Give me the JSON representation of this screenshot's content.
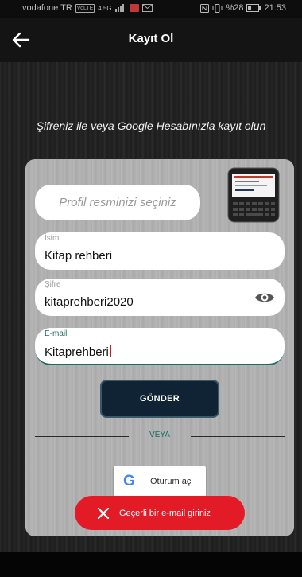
{
  "status_bar": {
    "carrier": "vodafone TR",
    "volte_badge": "VoLTE",
    "network": "4.5G",
    "battery_text": "%28",
    "time": "21:53"
  },
  "app_bar": {
    "title": "Kayıt Ol",
    "back_icon": "arrow-left-icon"
  },
  "subtitle": "Şifreniz ile veya Google Hesabınızla kayıt olun",
  "form": {
    "profile_button": "Profil resminizi seçiniz",
    "name": {
      "label": "İsim",
      "value": "Kitap rehberi"
    },
    "password": {
      "label": "Şifre",
      "value": "kitaprehberi2020",
      "icon": "eye-icon"
    },
    "email": {
      "label": "E-mail",
      "value": "Kitaprehberi"
    },
    "submit_label": "GÖNDER",
    "divider_text": "VEYA",
    "google_button": "Oturum aç"
  },
  "toast": {
    "message": "Geçerli bir e-mail giriniz",
    "icon": "close-icon"
  },
  "colors": {
    "accent": "#1b6d5f",
    "submit_bg": "#0f2335",
    "error": "#e21b26",
    "card": "#b3b3b3"
  }
}
